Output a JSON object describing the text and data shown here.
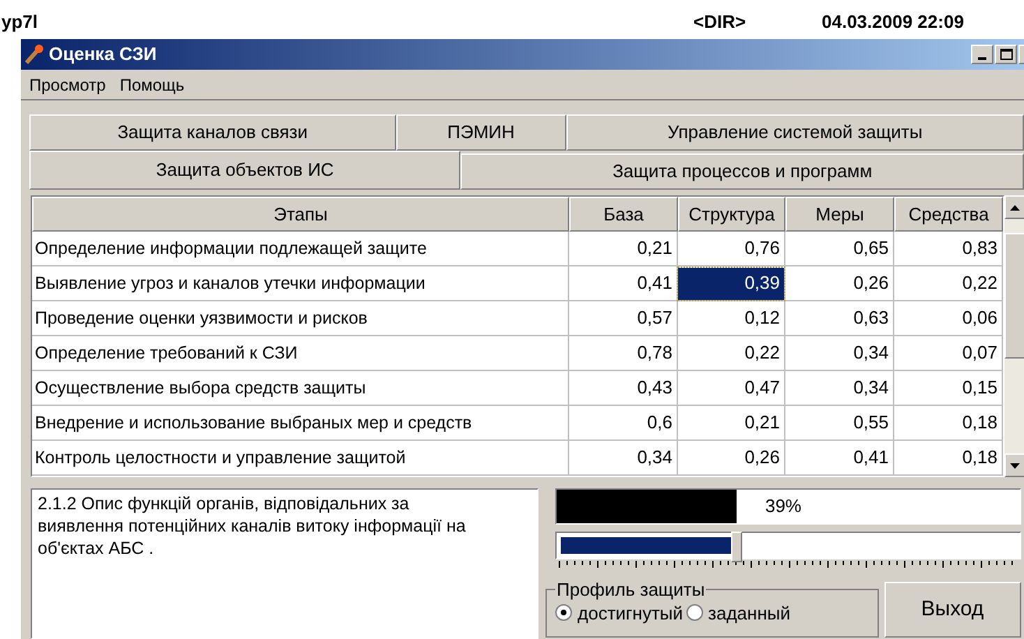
{
  "desktop": {
    "file_name": "yp7l",
    "file_type": "<DIR>",
    "file_date": "04.03.2009 22:09"
  },
  "window": {
    "title": "Оценка СЗИ"
  },
  "menu": [
    "Просмотр",
    "Помощь"
  ],
  "tab_rows": [
    [
      {
        "label": "Защита каналов связи",
        "selected": false
      },
      {
        "label": "ПЭМИН",
        "selected": false
      },
      {
        "label": "Управление системой защиты",
        "selected": false
      }
    ],
    [
      {
        "label": "Защита объектов ИС",
        "selected": true
      },
      {
        "label": "Защита процессов и программ",
        "selected": false
      }
    ]
  ],
  "table": {
    "columns": [
      "Этапы",
      "База",
      "Структура",
      "Меры",
      "Средства"
    ],
    "rows": [
      {
        "cells": [
          {
            "text": "Определение информации подлежащей защите",
            "selected": false
          },
          {
            "text": "0,21",
            "selected": false
          },
          {
            "text": "0,76",
            "selected": false
          },
          {
            "text": "0,65",
            "selected": false
          },
          {
            "text": "0,83",
            "selected": false
          }
        ]
      },
      {
        "cells": [
          {
            "text": "Выявление угроз и каналов утечки информации",
            "selected": false
          },
          {
            "text": "0,41",
            "selected": false
          },
          {
            "text": "0,39",
            "selected": true
          },
          {
            "text": "0,26",
            "selected": false
          },
          {
            "text": "0,22",
            "selected": false
          }
        ]
      },
      {
        "cells": [
          {
            "text": "Проведение оценки уязвимости и рисков",
            "selected": false
          },
          {
            "text": "0,57",
            "selected": false
          },
          {
            "text": "0,12",
            "selected": false
          },
          {
            "text": "0,63",
            "selected": false
          },
          {
            "text": "0,06",
            "selected": false
          }
        ]
      },
      {
        "cells": [
          {
            "text": "Определение требований к СЗИ",
            "selected": false
          },
          {
            "text": "0,78",
            "selected": false
          },
          {
            "text": "0,22",
            "selected": false
          },
          {
            "text": "0,34",
            "selected": false
          },
          {
            "text": "0,07",
            "selected": false
          }
        ]
      },
      {
        "cells": [
          {
            "text": "Осуществление выбора средств защиты",
            "selected": false
          },
          {
            "text": "0,43",
            "selected": false
          },
          {
            "text": "0,47",
            "selected": false
          },
          {
            "text": "0,34",
            "selected": false
          },
          {
            "text": "0,15",
            "selected": false
          }
        ]
      },
      {
        "cells": [
          {
            "text": "Внедрение и использование выбраных мер и средств",
            "selected": false
          },
          {
            "text": "0,6",
            "selected": false
          },
          {
            "text": "0,21",
            "selected": false
          },
          {
            "text": "0,55",
            "selected": false
          },
          {
            "text": "0,18",
            "selected": false
          }
        ]
      },
      {
        "cells": [
          {
            "text": "Контроль целостности и управление защитой",
            "selected": false
          },
          {
            "text": "0,34",
            "selected": false
          },
          {
            "text": "0,26",
            "selected": false
          },
          {
            "text": "0,41",
            "selected": false
          },
          {
            "text": "0,18",
            "selected": false
          }
        ]
      }
    ]
  },
  "description": "2.1.2 Опис функцій органів, відповідальних за виявлення потенційних каналів витоку інформації на об'єктах АБС .",
  "progress": {
    "level": 0.39,
    "reading": "39%"
  },
  "slider": {
    "level": 0.39
  },
  "profile": {
    "title": "Профиль защиты",
    "options": [
      {
        "label": "достигнутый",
        "selected": true
      },
      {
        "label": "заданный",
        "selected": false
      }
    ]
  },
  "exit_button": "Выход"
}
